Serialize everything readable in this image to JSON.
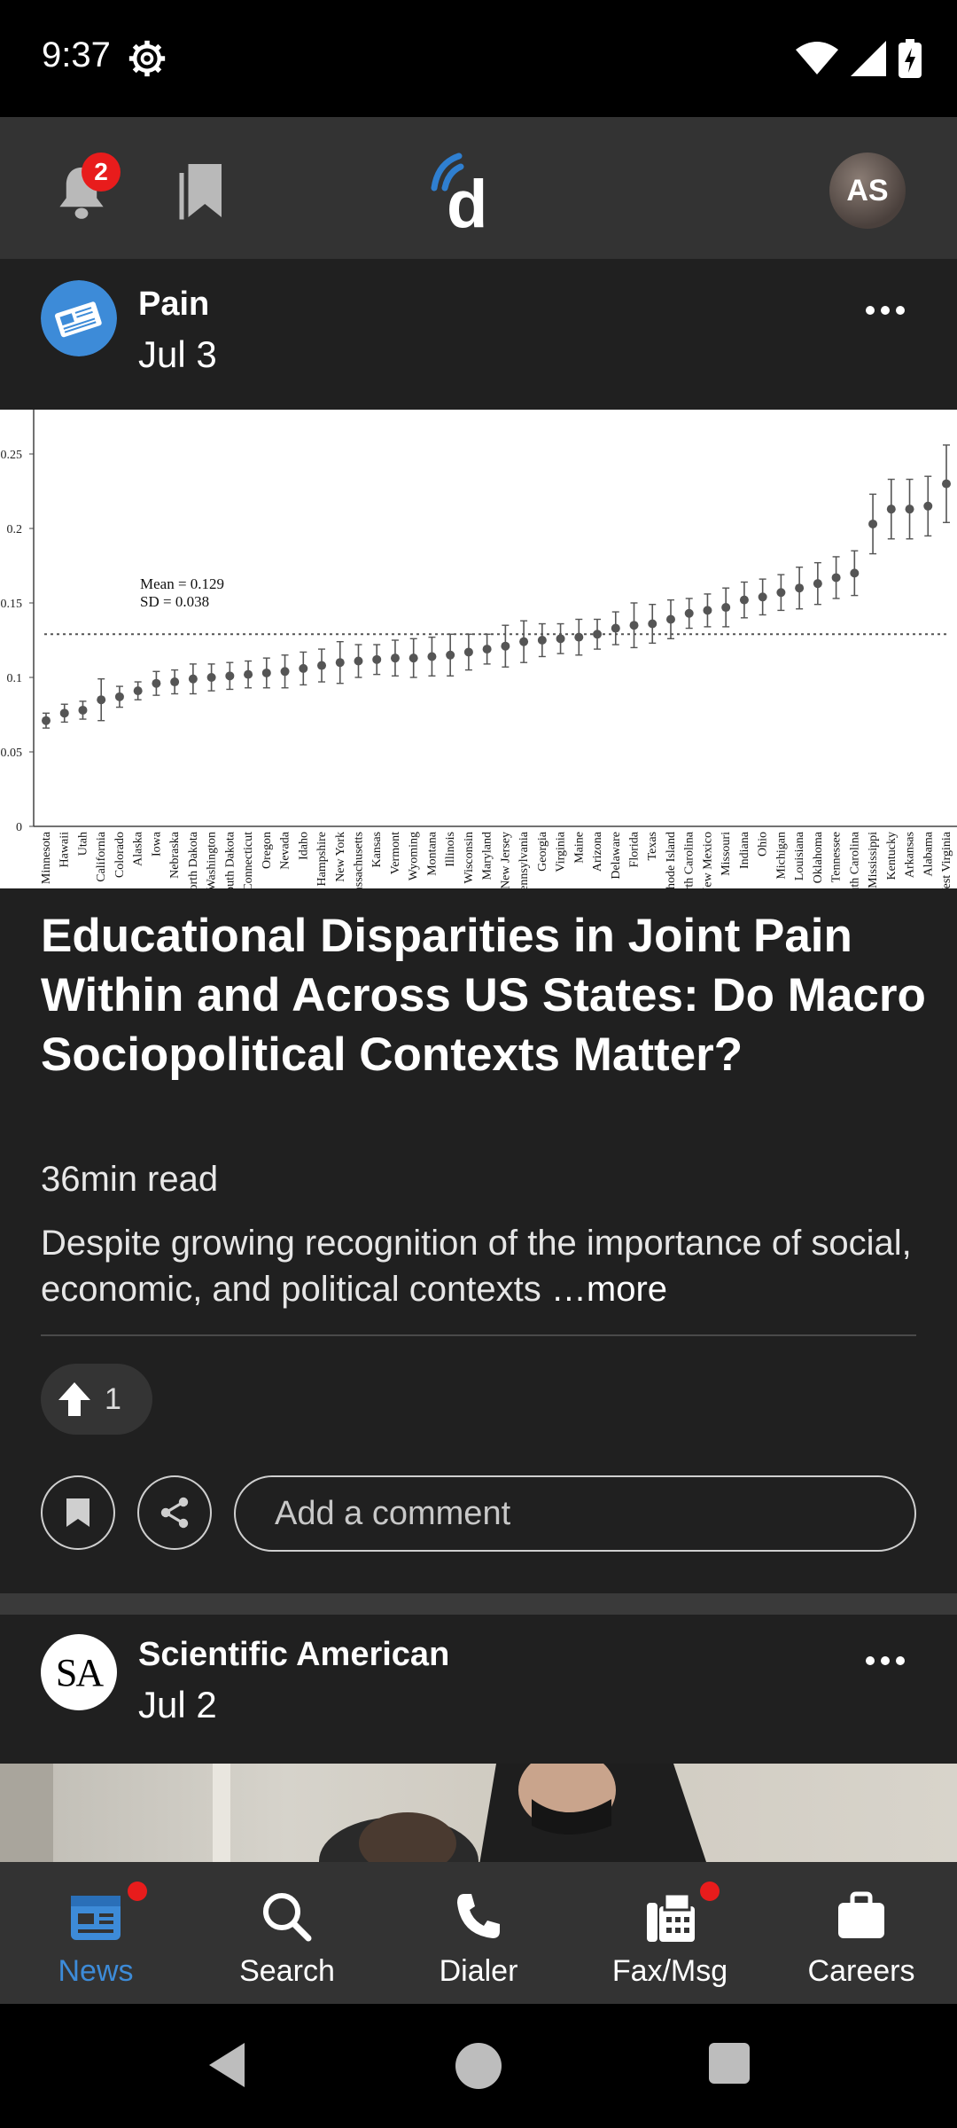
{
  "status_bar": {
    "time": "9:37"
  },
  "header": {
    "notification_count": "2",
    "logo_letter": "d",
    "avatar_initials": "AS"
  },
  "post1": {
    "source": "Pain",
    "date": "Jul 3",
    "chart": {
      "annotation_mean": "Mean = 0.129",
      "annotation_sd": "SD = 0.038",
      "y_ticks": [
        "0.25",
        "0.2",
        "0.15",
        "0.1",
        "0.05",
        "0"
      ]
    },
    "title": "Educational Disparities in Joint Pain Within and Across US States: Do Macro Sociopolitical Contexts Matter?",
    "read_time": "36min read",
    "summary": "Despite growing recognition of the importance of social, economic, and political contexts",
    "more_label": "…more",
    "upvotes": "1",
    "comment_placeholder": "Add a comment"
  },
  "post2": {
    "source": "Scientific American",
    "date": "Jul 2",
    "avatar_text": "SA"
  },
  "nav": {
    "items": [
      {
        "label": "News"
      },
      {
        "label": "Search"
      },
      {
        "label": "Dialer"
      },
      {
        "label": "Fax/Msg"
      },
      {
        "label": "Careers"
      }
    ]
  },
  "chart_data": {
    "type": "scatter",
    "title": "",
    "xlabel": "",
    "ylabel": "",
    "ylim": [
      0,
      0.25
    ],
    "reference_line": 0.129,
    "categories": [
      "Minnesota",
      "Hawaii",
      "Utah",
      "California",
      "Colorado",
      "Alaska",
      "Iowa",
      "Nebraska",
      "North Dakota",
      "Washington",
      "South Dakota",
      "Connecticut",
      "Oregon",
      "Nevada",
      "Idaho",
      "New Hampshire",
      "New York",
      "Massachusetts",
      "Kansas",
      "Vermont",
      "Wyoming",
      "Montana",
      "Illinois",
      "Wisconsin",
      "Maryland",
      "New Jersey",
      "Pennsylvania",
      "Georgia",
      "Virginia",
      "Maine",
      "Arizona",
      "Delaware",
      "Florida",
      "Texas",
      "Rhode Island",
      "North Carolina",
      "New Mexico",
      "Missouri",
      "Indiana",
      "Ohio",
      "Michigan",
      "Louisiana",
      "Oklahoma",
      "Tennessee",
      "South Carolina",
      "Mississippi",
      "Kentucky",
      "Arkansas",
      "Alabama",
      "West Virginia"
    ],
    "values": [
      0.071,
      0.076,
      0.078,
      0.085,
      0.087,
      0.091,
      0.096,
      0.097,
      0.099,
      0.1,
      0.101,
      0.102,
      0.103,
      0.104,
      0.106,
      0.108,
      0.11,
      0.111,
      0.112,
      0.113,
      0.113,
      0.114,
      0.115,
      0.117,
      0.119,
      0.121,
      0.124,
      0.125,
      0.126,
      0.127,
      0.129,
      0.133,
      0.135,
      0.136,
      0.139,
      0.143,
      0.145,
      0.147,
      0.152,
      0.154,
      0.157,
      0.16,
      0.163,
      0.167,
      0.17,
      0.203,
      0.213,
      0.213,
      0.215,
      0.23
    ],
    "error": [
      0.005,
      0.006,
      0.006,
      0.014,
      0.007,
      0.006,
      0.008,
      0.008,
      0.01,
      0.009,
      0.009,
      0.009,
      0.01,
      0.011,
      0.011,
      0.011,
      0.014,
      0.011,
      0.01,
      0.012,
      0.013,
      0.013,
      0.014,
      0.012,
      0.01,
      0.014,
      0.014,
      0.011,
      0.01,
      0.012,
      0.01,
      0.011,
      0.015,
      0.013,
      0.013,
      0.01,
      0.011,
      0.013,
      0.012,
      0.012,
      0.012,
      0.014,
      0.014,
      0.014,
      0.015,
      0.02,
      0.02,
      0.02,
      0.02,
      0.026
    ]
  }
}
